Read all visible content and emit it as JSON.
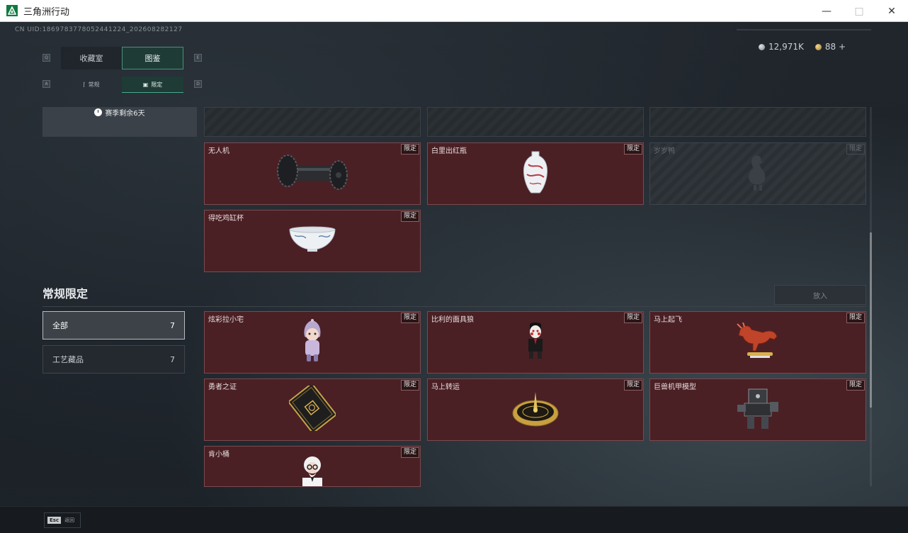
{
  "window": {
    "title": "三角洲行动"
  },
  "uid": "CN UID:1869783778052441224_202608282127",
  "currency": [
    {
      "icon": "silver-coin-icon",
      "value": "12,971K"
    },
    {
      "icon": "gold-coin-icon",
      "value": "88 +"
    }
  ],
  "main_tabs": [
    {
      "key": "Q",
      "label": "收藏室"
    },
    {
      "key": "E",
      "label": "图鉴"
    }
  ],
  "sub_tabs": [
    {
      "key": "A",
      "label": "常规"
    },
    {
      "key": "D",
      "label": "限定"
    }
  ],
  "season": {
    "text": "赛季剩余6天"
  },
  "top_cards": [
    {
      "name": "无人机",
      "badge": "限定",
      "locked": false,
      "icon": "drone-icon"
    },
    {
      "name": "白里出红瓶",
      "badge": "限定",
      "locked": false,
      "icon": "vase-icon"
    },
    {
      "name": "岁岁鸭",
      "badge": "限定",
      "locked": true,
      "icon": "duck-icon"
    },
    {
      "name": "得吃鸡缸杯",
      "badge": "限定",
      "locked": false,
      "icon": "cup-icon"
    }
  ],
  "section": {
    "title": "常规限定",
    "put_button": "放入",
    "filters": [
      {
        "label": "全部",
        "count": "7"
      },
      {
        "label": "工艺藏品",
        "count": "7"
      }
    ]
  },
  "cards": [
    {
      "name": "炫彩拉小宅",
      "badge": "限定",
      "icon": "doll-icon"
    },
    {
      "name": "比利的面具狼",
      "badge": "限定",
      "icon": "puppet-icon"
    },
    {
      "name": "马上起飞",
      "badge": "限定",
      "icon": "horse-icon"
    },
    {
      "name": "勇者之证",
      "badge": "限定",
      "icon": "card-icon"
    },
    {
      "name": "马上转运",
      "badge": "限定",
      "icon": "compass-icon"
    },
    {
      "name": "巨兽机甲模型",
      "badge": "限定",
      "icon": "mech-icon"
    },
    {
      "name": "肯小桶",
      "badge": "限定",
      "icon": "colonel-icon"
    }
  ],
  "bottom": {
    "esc_key": "Esc",
    "esc_label": "返回"
  }
}
